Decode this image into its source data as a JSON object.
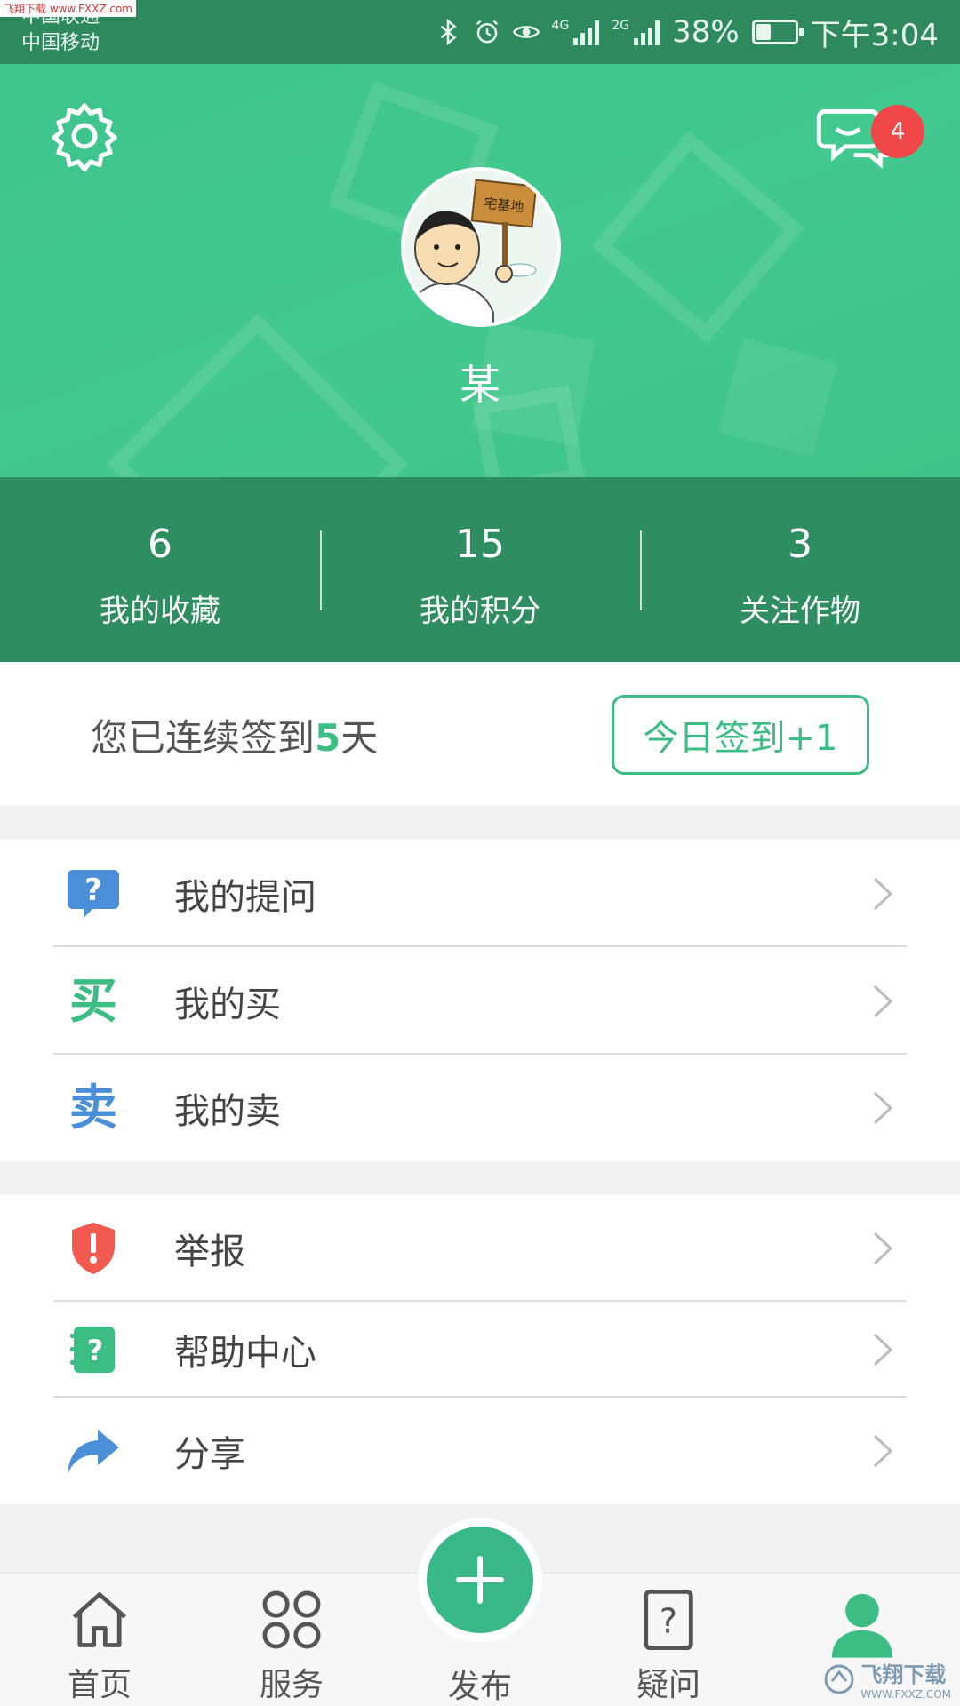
{
  "status_bar": {
    "carrier_1": "中国联通",
    "carrier_2": "中国移动",
    "net_1": "4G",
    "net_2": "2G",
    "battery_percent": "38%",
    "battery_level": 0.38,
    "time": "下午3:04"
  },
  "header": {
    "message_badge": "4",
    "avatar_sign": "宅基地",
    "username": "某"
  },
  "stats": [
    {
      "value": "6",
      "label": "我的收藏"
    },
    {
      "value": "15",
      "label": "我的积分"
    },
    {
      "value": "3",
      "label": "关注作物"
    }
  ],
  "checkin": {
    "prefix": "您已连续签到",
    "days": "5",
    "suffix": "天",
    "button_label": "今日签到+1"
  },
  "menu_group_1": [
    {
      "label": "我的提问",
      "icon": "question-bubble-icon"
    },
    {
      "label": "我的买",
      "icon": "buy-icon",
      "glyph": "买",
      "color": "#3bbd84"
    },
    {
      "label": "我的卖",
      "icon": "sell-icon",
      "glyph": "卖",
      "color": "#4a8fd8"
    }
  ],
  "menu_group_2": [
    {
      "label": "举报",
      "icon": "shield-alert-icon"
    },
    {
      "label": "帮助中心",
      "icon": "help-book-icon"
    },
    {
      "label": "分享",
      "icon": "share-arrow-icon"
    }
  ],
  "tabbar": {
    "home": "首页",
    "services": "服务",
    "publish": "发布",
    "questions": "疑问",
    "profile_icon": "person-icon"
  },
  "watermarks": {
    "top_left": "飞翔下载 www.FXXZ.com",
    "bottom_right": "飞翔下载",
    "bottom_right_sub": "WWW.FXXZ.COM"
  },
  "colors": {
    "header_green": "#42c98f",
    "stats_green": "#2f8d62",
    "accent": "#3bbd84",
    "badge_red": "#f04848",
    "blue": "#4a8fd8"
  }
}
